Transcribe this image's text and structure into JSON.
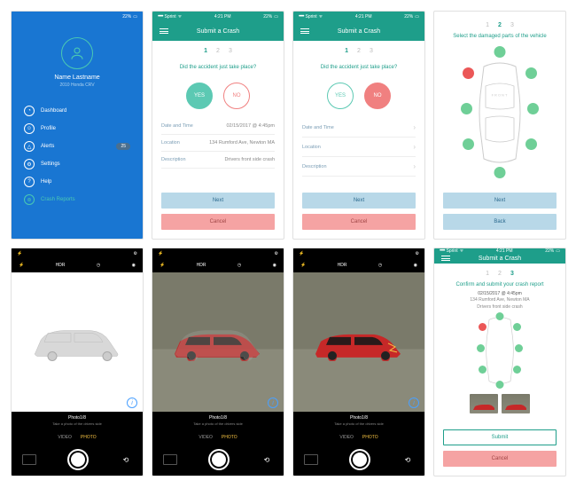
{
  "statusbar": {
    "carrier": "Sprint",
    "time": "4:21 PM",
    "battery": "22%"
  },
  "sidebar": {
    "name": "Name Lastname",
    "car": "2010 Honda CRV",
    "items": [
      {
        "label": "Dashboard"
      },
      {
        "label": "Profile"
      },
      {
        "label": "Alerts",
        "badge": "25"
      },
      {
        "label": "Settings"
      },
      {
        "label": "Help"
      },
      {
        "label": "Crash Reports"
      }
    ]
  },
  "header": {
    "title": "Submit a Crash"
  },
  "step1": {
    "prompt": "Did the accident just take place?",
    "yes": "YES",
    "no": "NO",
    "rows": {
      "date_label": "Date and Time",
      "date_value": "02/15/2017 @ 4:45pm",
      "loc_label": "Location",
      "loc_value": "134 Rumford Ave, Newton MA",
      "desc_label": "Description",
      "desc_value": "Drivers front side crash"
    }
  },
  "step2": {
    "subtitle": "Select the damaged parts of the vehicle",
    "front": "FRONT"
  },
  "step3": {
    "subtitle": "Confirm and submit your crash report",
    "dt": "02/15/2017 @ 4:45pm",
    "addr": "134 Rumford Ave, Newton MA",
    "desc": "Drivers front side crash"
  },
  "buttons": {
    "next": "Next",
    "cancel": "Cancel",
    "back": "Back",
    "submit": "Submit"
  },
  "steps": {
    "s1": "1",
    "s2": "2",
    "s3": "3"
  },
  "camera": {
    "hdr": "HDR",
    "counter": "Photo1/8",
    "hint": "Take a photo of the drivers side",
    "video": "VIDEO",
    "photo": "PHOTO"
  }
}
